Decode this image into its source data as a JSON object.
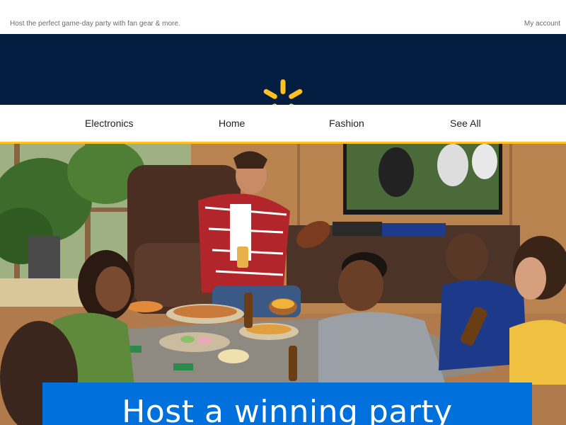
{
  "preheader": {
    "text": "Host the perfect game-day party with fan gear & more.",
    "account_label": "My account"
  },
  "brand": {
    "logo_icon": "spark-icon",
    "bar_color": "#041e42",
    "logo_color": "#ffc220"
  },
  "nav": {
    "items": [
      {
        "label": "Electronics"
      },
      {
        "label": "Home"
      },
      {
        "label": "Fashion"
      },
      {
        "label": "See All"
      }
    ],
    "underline_color": "#ffc220"
  },
  "hero": {
    "image": "friends-watching-football-photo",
    "banner_title": "Host a winning party",
    "banner_color": "#0071dc"
  }
}
